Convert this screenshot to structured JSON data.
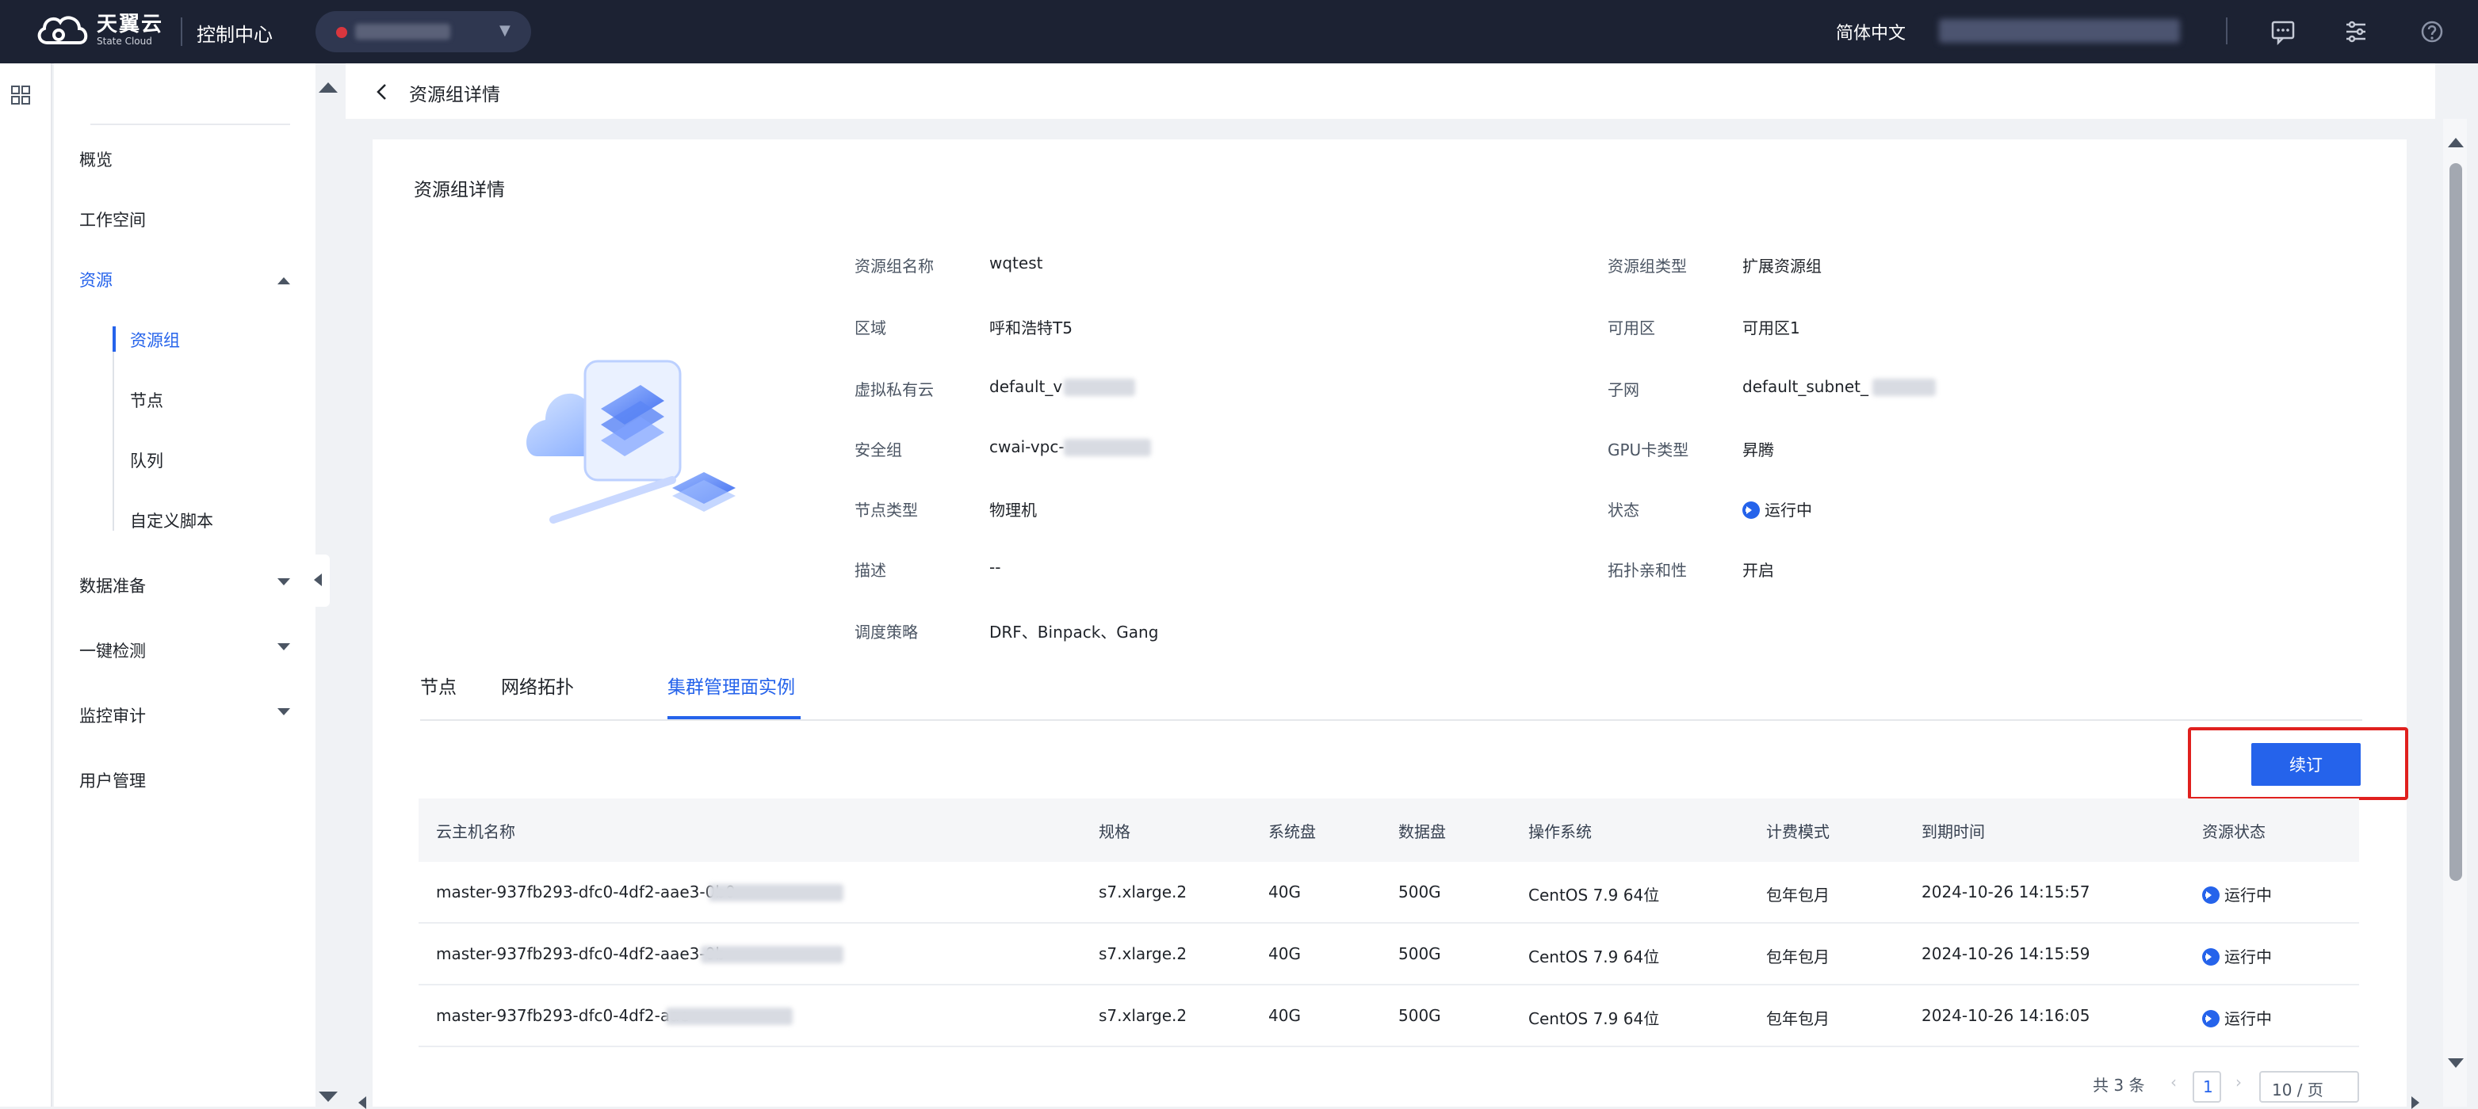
{
  "header": {
    "logo_text": "天翼云",
    "logo_sub": "State Cloud",
    "console_title": "控制中心",
    "language": "简体中文"
  },
  "sidebar": {
    "items": [
      {
        "label": "概览"
      },
      {
        "label": "工作空间"
      },
      {
        "label": "资源"
      },
      {
        "label": "数据准备"
      },
      {
        "label": "一键检测"
      },
      {
        "label": "监控审计"
      },
      {
        "label": "用户管理"
      }
    ],
    "sub_items": [
      {
        "label": "资源组"
      },
      {
        "label": "节点"
      },
      {
        "label": "队列"
      },
      {
        "label": "自定义脚本"
      }
    ]
  },
  "breadcrumb": {
    "title": "资源组详情"
  },
  "detail": {
    "title": "资源组详情",
    "left": [
      {
        "label": "资源组名称",
        "value": "wqtest"
      },
      {
        "label": "区域",
        "value": "呼和浩特T5"
      },
      {
        "label": "虚拟私有云",
        "value": "default_v"
      },
      {
        "label": "安全组",
        "value": "cwai-vpc-"
      },
      {
        "label": "节点类型",
        "value": "物理机"
      },
      {
        "label": "描述",
        "value": "--"
      },
      {
        "label": "调度策略",
        "value": "DRF、Binpack、Gang"
      }
    ],
    "right": [
      {
        "label": "资源组类型",
        "value": "扩展资源组"
      },
      {
        "label": "可用区",
        "value": "可用区1"
      },
      {
        "label": "子网",
        "value": "default_subnet_"
      },
      {
        "label": "GPU卡类型",
        "value": "昇腾"
      },
      {
        "label": "状态",
        "value": "运行中"
      },
      {
        "label": "拓扑亲和性",
        "value": "开启"
      }
    ]
  },
  "tabs": [
    {
      "label": "节点"
    },
    {
      "label": "网络拓扑"
    },
    {
      "label": "集群管理面实例"
    }
  ],
  "renew_button": "续订",
  "table": {
    "columns": [
      "云主机名称",
      "规格",
      "系统盘",
      "数据盘",
      "操作系统",
      "计费模式",
      "到期时间",
      "资源状态"
    ],
    "rows": [
      [
        "master-937fb293-dfc0-4df2-aae3-0b0",
        "s7.xlarge.2",
        "40G",
        "500G",
        "CentOS 7.9 64位",
        "包年包月",
        "2024-10-26 14:15:57",
        "运行中"
      ],
      [
        "master-937fb293-dfc0-4df2-aae3-0b",
        "s7.xlarge.2",
        "40G",
        "500G",
        "CentOS 7.9 64位",
        "包年包月",
        "2024-10-26 14:15:59",
        "运行中"
      ],
      [
        "master-937fb293-dfc0-4df2-aae",
        "s7.xlarge.2",
        "40G",
        "500G",
        "CentOS 7.9 64位",
        "包年包月",
        "2024-10-26 14:16:05",
        "运行中"
      ]
    ]
  },
  "pagination": {
    "total": "共 3 条",
    "current_page": "1",
    "page_size": "10 / 页"
  },
  "colors": {
    "accent": "#2563eb",
    "topbar": "#1c2233",
    "highlight": "#e0201e"
  }
}
